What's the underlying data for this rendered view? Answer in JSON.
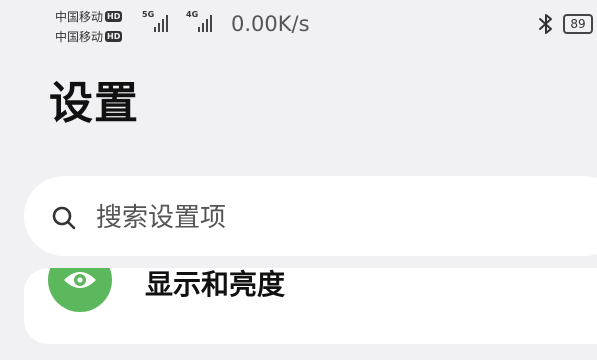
{
  "status_bar": {
    "carriers": [
      {
        "name": "中国移动",
        "badge": "HD"
      },
      {
        "name": "中国移动",
        "badge": "HD"
      }
    ],
    "signals": [
      {
        "tech": "5G",
        "level": 4
      },
      {
        "tech": "4G",
        "level": 4
      }
    ],
    "net_speed": "0.00K/s",
    "battery_level": "89",
    "icons": [
      "bluetooth-icon",
      "battery-icon"
    ]
  },
  "page": {
    "title": "设置"
  },
  "search": {
    "placeholder": "搜索设置项",
    "value": ""
  },
  "settings_items": [
    {
      "label": "显示和亮度",
      "icon": "eye-icon",
      "icon_color": "#5cb85c"
    }
  ],
  "colors": {
    "background": "#f1f1f3",
    "card": "#ffffff",
    "accent_green": "#5cb85c"
  }
}
